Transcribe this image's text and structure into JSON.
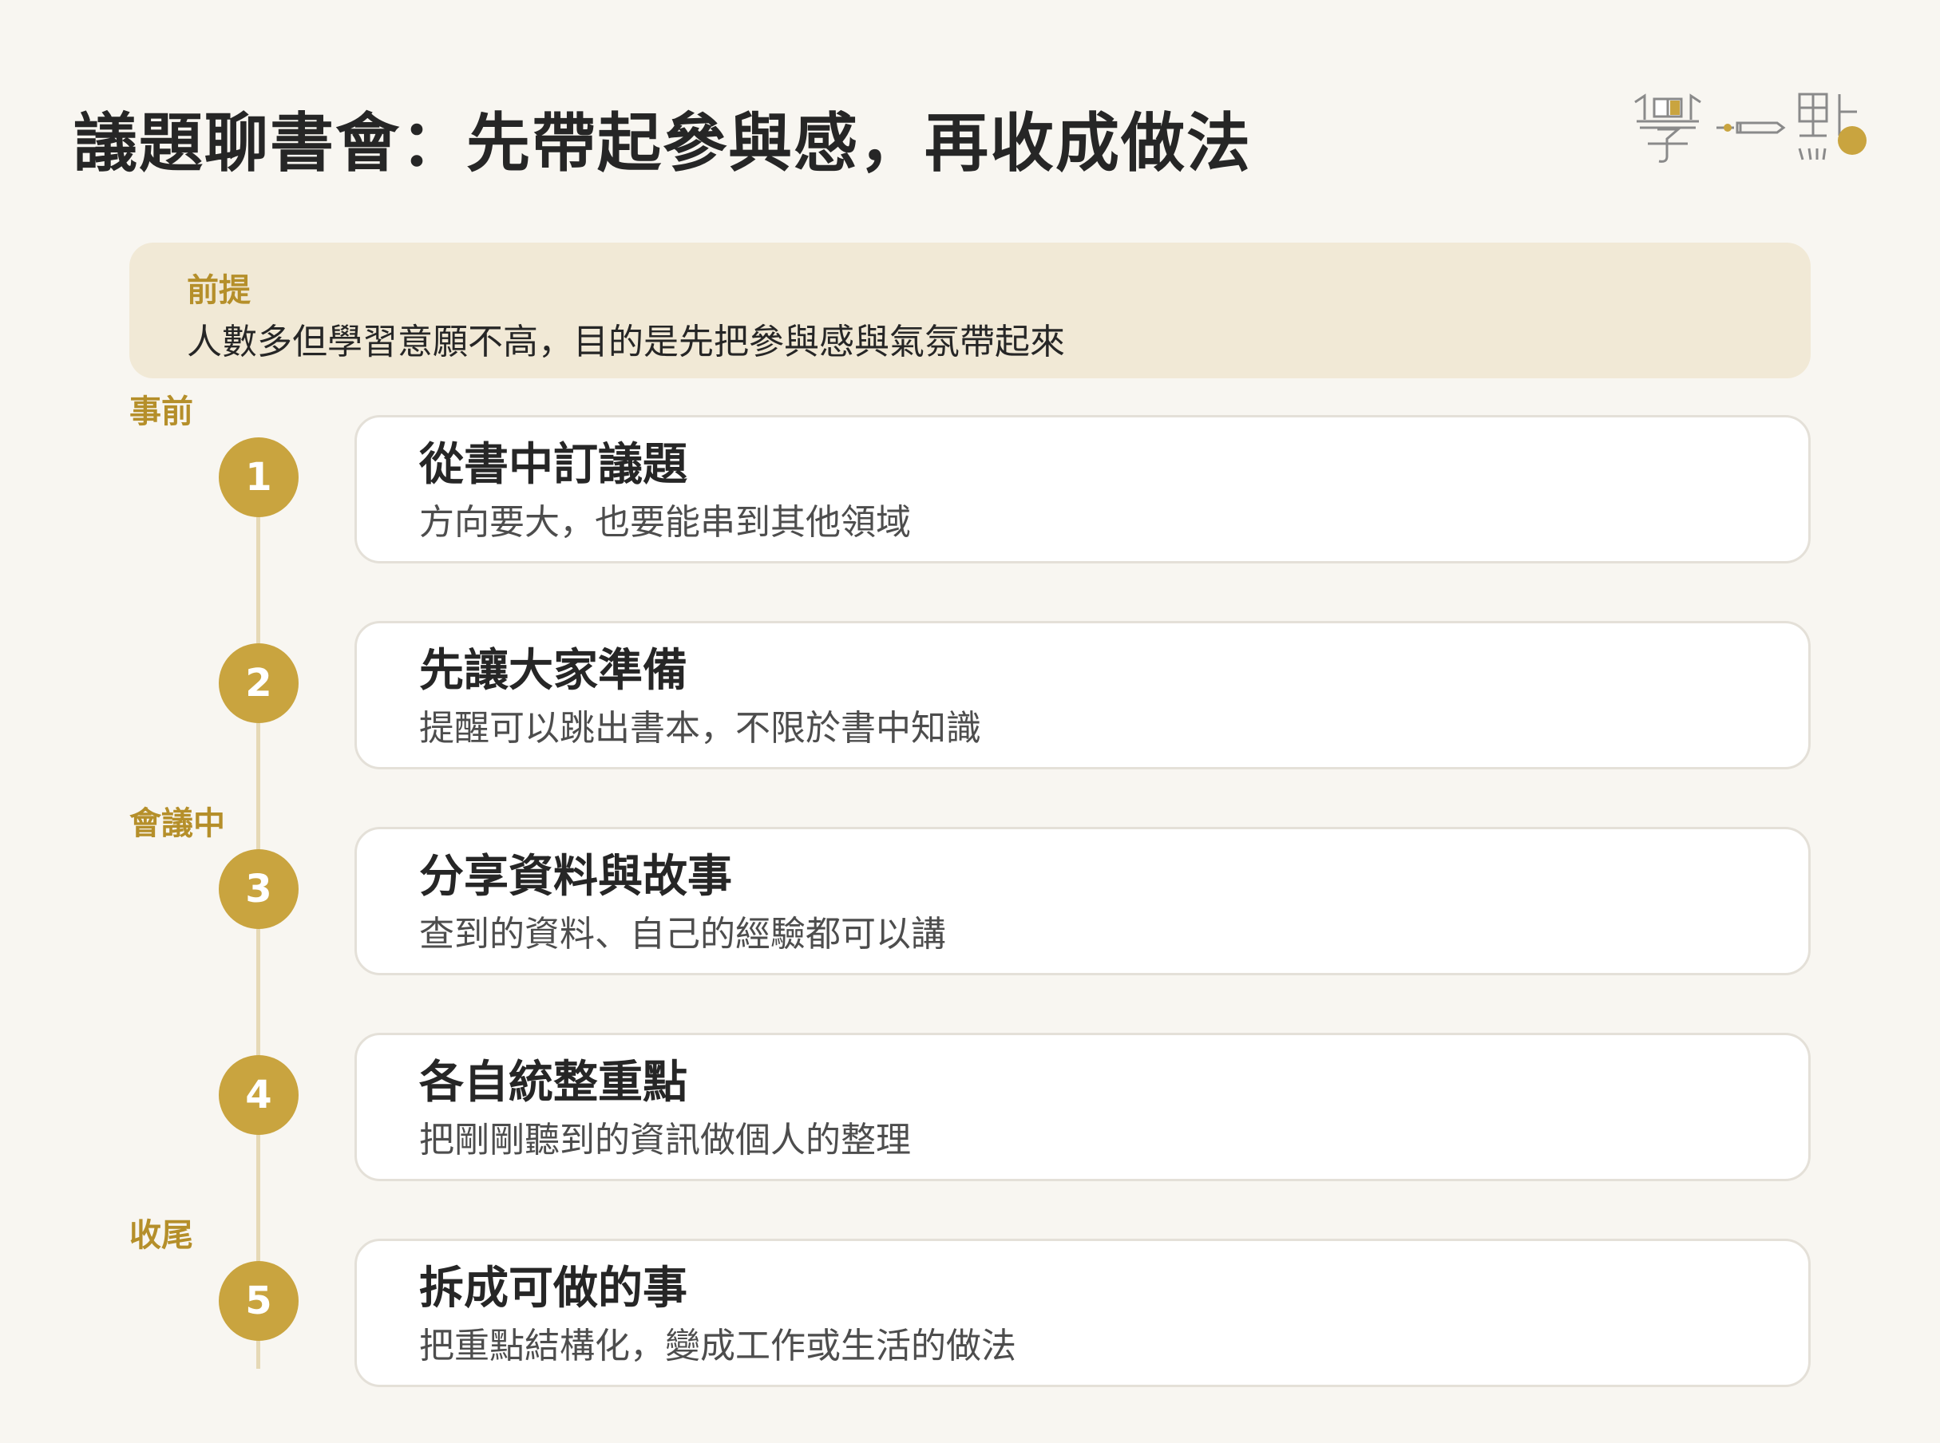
{
  "title": "議題聊書會：先帶起參與感，再收成做法",
  "colors": {
    "accent": "#c9a43f",
    "accent_text": "#b58f2a",
    "premise_bg": "#f1e9d6",
    "page_bg": "#f8f6f1",
    "line": "#e6d9b6"
  },
  "logo": {
    "icons": [
      "learn-book-icon",
      "pen-icon",
      "dot-icon"
    ]
  },
  "premise": {
    "label": "前提",
    "text": "人數多但學習意願不高，目的是先把參與感與氣氛帶起來"
  },
  "phases": {
    "before": "事前",
    "during": "會議中",
    "closing": "收尾"
  },
  "steps": [
    {
      "number": "1",
      "title": "從書中訂議題",
      "desc": "方向要大，也要能串到其他領域"
    },
    {
      "number": "2",
      "title": "先讓大家準備",
      "desc": "提醒可以跳出書本，不限於書中知識"
    },
    {
      "number": "3",
      "title": "分享資料與故事",
      "desc": "查到的資料、自己的經驗都可以講"
    },
    {
      "number": "4",
      "title": "各自統整重點",
      "desc": "把剛剛聽到的資訊做個人的整理"
    },
    {
      "number": "5",
      "title": "拆成可做的事",
      "desc": "把重點結構化，變成工作或生活的做法"
    }
  ]
}
